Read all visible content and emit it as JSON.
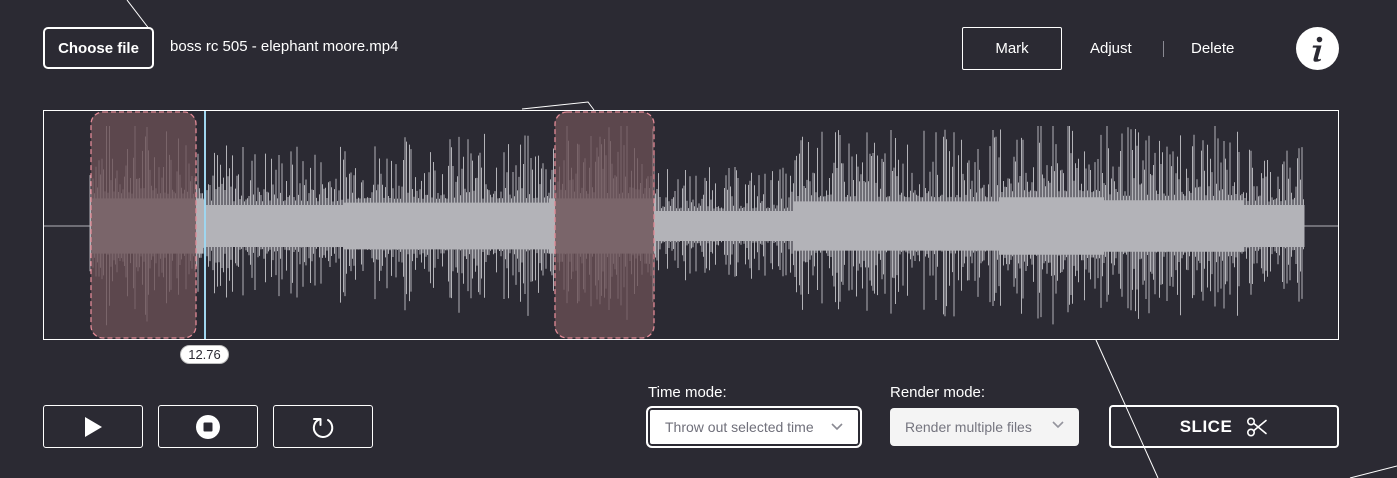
{
  "file": {
    "button_label": "Choose file",
    "name": "boss rc 505 - elephant moore.mp4"
  },
  "modes": {
    "mark_label": "Mark",
    "adjust_label": "Adjust",
    "delete_label": "Delete",
    "active": "Mark"
  },
  "info": {
    "icon": "info-icon"
  },
  "waveform": {
    "duration_label_cursor": "12.76",
    "cursor_color": "#9fd6ef",
    "wave_color": "#b3b3b8",
    "selection_fill": "#6a4f55",
    "selection_border": "#e28a96"
  },
  "controls": {
    "play_icon": "play-icon",
    "stop_icon": "stop-icon",
    "reset_icon": "reset-icon"
  },
  "time_mode": {
    "label": "Time mode:",
    "selected": "Throw out selected time"
  },
  "render_mode": {
    "label": "Render mode:",
    "selected": "Render multiple files"
  },
  "slice": {
    "label": "SLICE",
    "icon": "scissors-icon"
  },
  "colors": {
    "background": "#2b2a33",
    "foreground": "#ffffff"
  }
}
